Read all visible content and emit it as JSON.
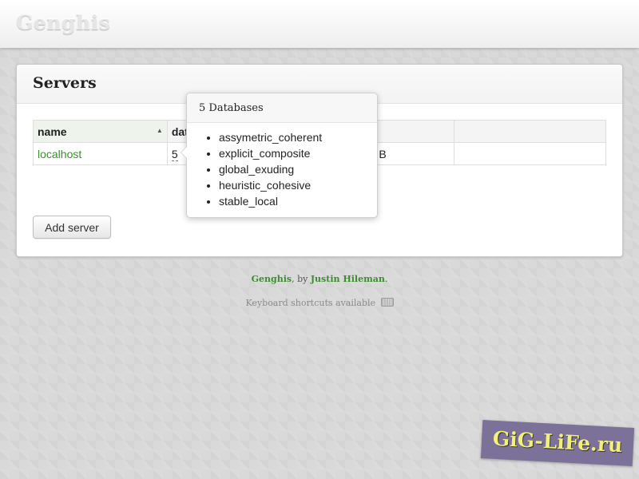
{
  "app": {
    "brand": "Genghis"
  },
  "panel": {
    "title": "Servers",
    "add_server_label": "Add server"
  },
  "table": {
    "columns": [
      {
        "label": "name",
        "sorted": true,
        "sort_dir": "ascending"
      },
      {
        "label": "dat"
      },
      {
        "label": ""
      },
      {
        "label": ""
      }
    ],
    "rows": [
      {
        "name": "localhost",
        "databases": "5",
        "size": "B",
        "actions": ""
      }
    ]
  },
  "popover": {
    "title": "5 Databases",
    "databases": [
      "assymetric_coherent",
      "explicit_composite",
      "global_exuding",
      "heuristic_cohesive",
      "stable_local"
    ]
  },
  "footer": {
    "app_link": "Genghis",
    "by_text": ", by ",
    "author_link": "Justin Hileman",
    "period": ".",
    "shortcuts_text": "Keyboard shortcuts available",
    "shortcuts_icon": "keyboard-icon"
  },
  "watermark": {
    "text": "GiG-LiFe.ru"
  },
  "colors": {
    "accent": "#3b8e2d",
    "watermark_bg": "#7c7198",
    "watermark_text": "#f2ef7a"
  }
}
